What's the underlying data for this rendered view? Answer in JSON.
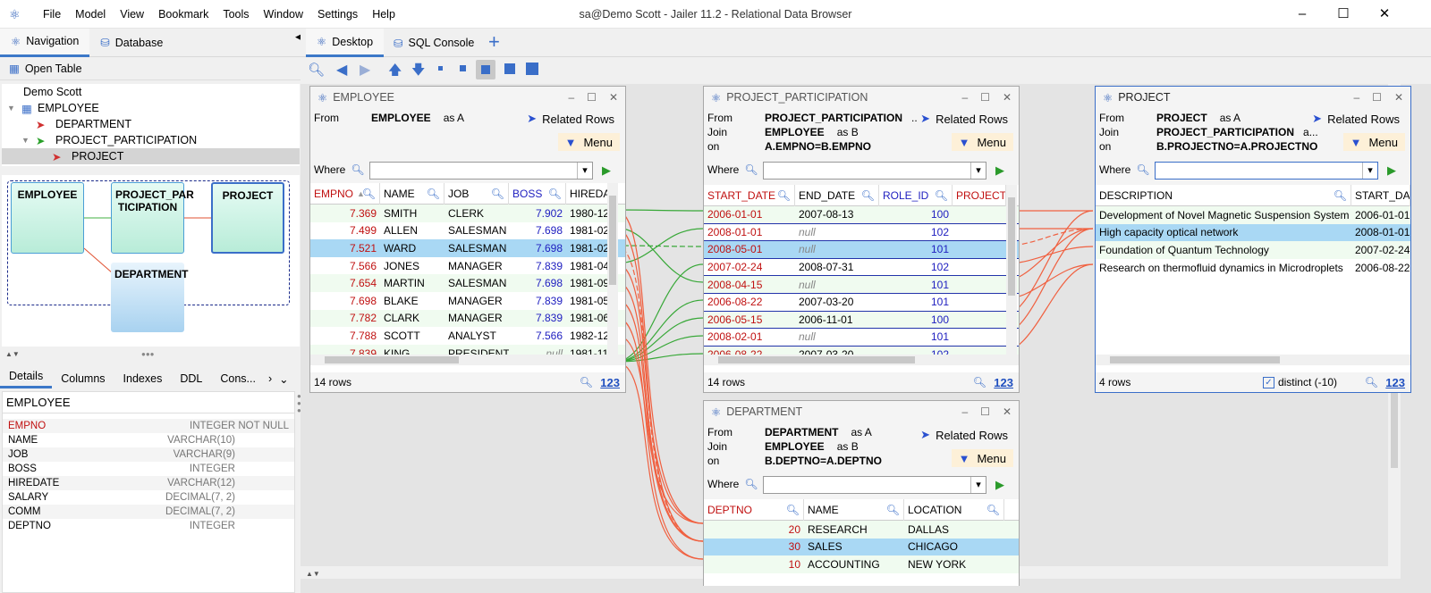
{
  "menu": [
    "File",
    "Model",
    "View",
    "Bookmark",
    "Tools",
    "Window",
    "Settings",
    "Help"
  ],
  "window_title": "sa@Demo Scott - Jailer 11.2 - Relational Data Browser",
  "left": {
    "tabs": [
      "Navigation",
      "Database"
    ],
    "open_table": "Open Table",
    "tree": [
      "Demo Scott",
      "EMPLOYEE",
      "DEPARTMENT",
      "PROJECT_PARTICIPATION",
      "PROJECT"
    ],
    "diagram": {
      "employee": "EMPLOYEE",
      "pp": "PROJECT_PAR TICIPATION",
      "project": "PROJECT",
      "department": "DEPARTMENT"
    },
    "detail_tabs": [
      "Details",
      "Columns",
      "Indexes",
      "DDL",
      "Cons..."
    ],
    "detail_table": "EMPLOYEE",
    "columns": [
      [
        "EMPNO",
        "INTEGER NOT NULL"
      ],
      [
        "NAME",
        "VARCHAR(10)"
      ],
      [
        "JOB",
        "VARCHAR(9)"
      ],
      [
        "BOSS",
        "INTEGER"
      ],
      [
        "HIREDATE",
        "VARCHAR(12)"
      ],
      [
        "SALARY",
        "DECIMAL(7, 2)"
      ],
      [
        "COMM",
        "DECIMAL(7, 2)"
      ],
      [
        "DEPTNO",
        "INTEGER"
      ]
    ]
  },
  "desk_tabs": [
    "Desktop",
    "SQL Console",
    "+"
  ],
  "common": {
    "from": "From",
    "join": "Join",
    "on": "on",
    "as_a": "as A",
    "as_b": "as B",
    "related": "Related Rows",
    "menu": "Menu",
    "where": "Where",
    "n123": "123"
  },
  "employee": {
    "title": "EMPLOYEE",
    "from_table": "EMPLOYEE",
    "headers": [
      "EMPNO",
      "NAME",
      "JOB",
      "BOSS",
      "HIREDAT"
    ],
    "rows": [
      [
        "7.369",
        "SMITH",
        "CLERK",
        "7.902",
        "1980-12-"
      ],
      [
        "7.499",
        "ALLEN",
        "SALESMAN",
        "7.698",
        "1981-02-"
      ],
      [
        "7.521",
        "WARD",
        "SALESMAN",
        "7.698",
        "1981-02-"
      ],
      [
        "7.566",
        "JONES",
        "MANAGER",
        "7.839",
        "1981-04-"
      ],
      [
        "7.654",
        "MARTIN",
        "SALESMAN",
        "7.698",
        "1981-09-"
      ],
      [
        "7.698",
        "BLAKE",
        "MANAGER",
        "7.839",
        "1981-05-"
      ],
      [
        "7.782",
        "CLARK",
        "MANAGER",
        "7.839",
        "1981-06-"
      ],
      [
        "7.788",
        "SCOTT",
        "ANALYST",
        "7.566",
        "1982-12-"
      ],
      [
        "7.839",
        "KING",
        "PRESIDENT",
        "null",
        "1981-11-"
      ]
    ],
    "count": "14 rows"
  },
  "pp": {
    "title": "PROJECT_PARTICIPATION",
    "from_table": "PROJECT_PARTICIPATION",
    "join_table": "EMPLOYEE",
    "on": "A.EMPNO=B.EMPNO",
    "ellipsis": "...",
    "headers": [
      "START_DATE",
      "END_DATE",
      "ROLE_ID",
      "PROJECTN"
    ],
    "rows": [
      [
        "2006-01-01",
        "2007-08-13",
        "100"
      ],
      [
        "2008-01-01",
        "null",
        "102"
      ],
      [
        "2008-05-01",
        "null",
        "101"
      ],
      [
        "2007-02-24",
        "2008-07-31",
        "102"
      ],
      [
        "2008-04-15",
        "null",
        "101"
      ],
      [
        "2006-08-22",
        "2007-03-20",
        "101"
      ],
      [
        "2006-05-15",
        "2006-11-01",
        "100"
      ],
      [
        "2008-02-01",
        "null",
        "101"
      ],
      [
        "2006-08-22",
        "2007-03-20",
        "102"
      ]
    ],
    "count": "14 rows"
  },
  "project": {
    "title": "PROJECT",
    "from_table": "PROJECT",
    "join_table": "PROJECT_PARTICIPATION",
    "on": "B.PROJECTNO=A.PROJECTNO",
    "ellipsis": "a...",
    "headers": [
      "DESCRIPTION",
      "START_DATI"
    ],
    "rows": [
      [
        "Development of Novel Magnetic Suspension System",
        "2006-01-01"
      ],
      [
        "High capacity optical network",
        "2008-01-01"
      ],
      [
        "Foundation of Quantum Technology",
        "2007-02-24"
      ],
      [
        "Research on thermofluid dynamics in Microdroplets",
        "2006-08-22"
      ]
    ],
    "count": "4 rows",
    "distinct": "distinct (-10)"
  },
  "department": {
    "title": "DEPARTMENT",
    "from_table": "DEPARTMENT",
    "join_table": "EMPLOYEE",
    "on": "B.DEPTNO=A.DEPTNO",
    "headers": [
      "DEPTNO",
      "NAME",
      "LOCATION"
    ],
    "rows": [
      [
        "20",
        "RESEARCH",
        "DALLAS"
      ],
      [
        "30",
        "SALES",
        "CHICAGO"
      ],
      [
        "10",
        "ACCOUNTING",
        "NEW YORK"
      ]
    ]
  }
}
